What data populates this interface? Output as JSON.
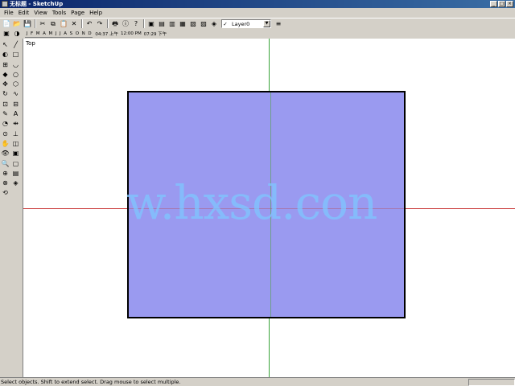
{
  "window": {
    "title": "无标题 - SketchUp",
    "controls": [
      "_",
      "□",
      "×"
    ]
  },
  "menubar": {
    "items": [
      "File",
      "Edit",
      "View",
      "Tools",
      "Page",
      "Help"
    ]
  },
  "toolbar": {
    "layer_check": "✓",
    "layer_name": "Layer0",
    "icons": {
      "new": "📄",
      "open": "📂",
      "save": "💾",
      "cut": "✂",
      "copy": "⧉",
      "paste": "📋",
      "erase": "✕",
      "undo": "↶",
      "redo": "↷",
      "print": "🖶",
      "model-info": "ⓘ",
      "whats-this": "?",
      "camera": "▣",
      "top": "▤",
      "front": "▥",
      "right": "▦",
      "back": "▧",
      "left": "▨",
      "iso": "◈",
      "layers": "≡"
    }
  },
  "shadows": {
    "months": [
      "J",
      "F",
      "M",
      "A",
      "M",
      "J",
      "J",
      "A",
      "S",
      "O",
      "N",
      "D"
    ],
    "sunrise": "04:37 上午",
    "noon": "12:00 PM",
    "sunset": "07:29 下午"
  },
  "palette": {
    "tools": [
      [
        "select-arrow",
        "line-pencil"
      ],
      [
        "paint-bucket",
        "rectangle"
      ],
      [
        "component",
        "arc"
      ],
      [
        "eraser",
        "circle"
      ],
      [
        "move",
        "polygon"
      ],
      [
        "rotate",
        "freehand"
      ],
      [
        "scale",
        "push-pull"
      ],
      [
        "tape-measure",
        "text"
      ],
      [
        "protractor",
        "dimension"
      ],
      [
        "orbit",
        "axes"
      ],
      [
        "walk",
        "section"
      ],
      [
        "look-around",
        "view-top"
      ],
      [
        "zoom",
        "view-front"
      ],
      [
        "zoom-window",
        "view-right"
      ],
      [
        "zoom-extents",
        "view-iso"
      ],
      [
        "previous-view",
        ""
      ]
    ],
    "glyphs": {
      "select-arrow": "↖",
      "line-pencil": "╱",
      "paint-bucket": "◐",
      "rectangle": "□",
      "component": "⊞",
      "arc": "◡",
      "eraser": "◆",
      "circle": "○",
      "move": "✥",
      "polygon": "⬡",
      "rotate": "↻",
      "freehand": "∿",
      "scale": "⊡",
      "push-pull": "⊟",
      "tape-measure": "✎",
      "text": "A",
      "protractor": "◔",
      "dimension": "⇹",
      "orbit": "⊙",
      "axes": "⊥",
      "walk": "✋",
      "section": "◫",
      "look-around": "👁",
      "view-top": "▣",
      "zoom": "🔍",
      "view-front": "▢",
      "zoom-window": "⊕",
      "view-right": "▤",
      "zoom-extents": "⊗",
      "view-iso": "◈",
      "previous-view": "⟲"
    }
  },
  "viewport": {
    "view_name": "Top",
    "face_color": "#9a9af0",
    "red_axis_color": "#c83232",
    "green_axis_color": "#37a337",
    "watermark": "w.hxsd.con"
  },
  "statusbar": {
    "message": "Select objects. Shift to extend select. Drag mouse to select multiple.",
    "vcb_label": "",
    "vcb_value": ""
  }
}
